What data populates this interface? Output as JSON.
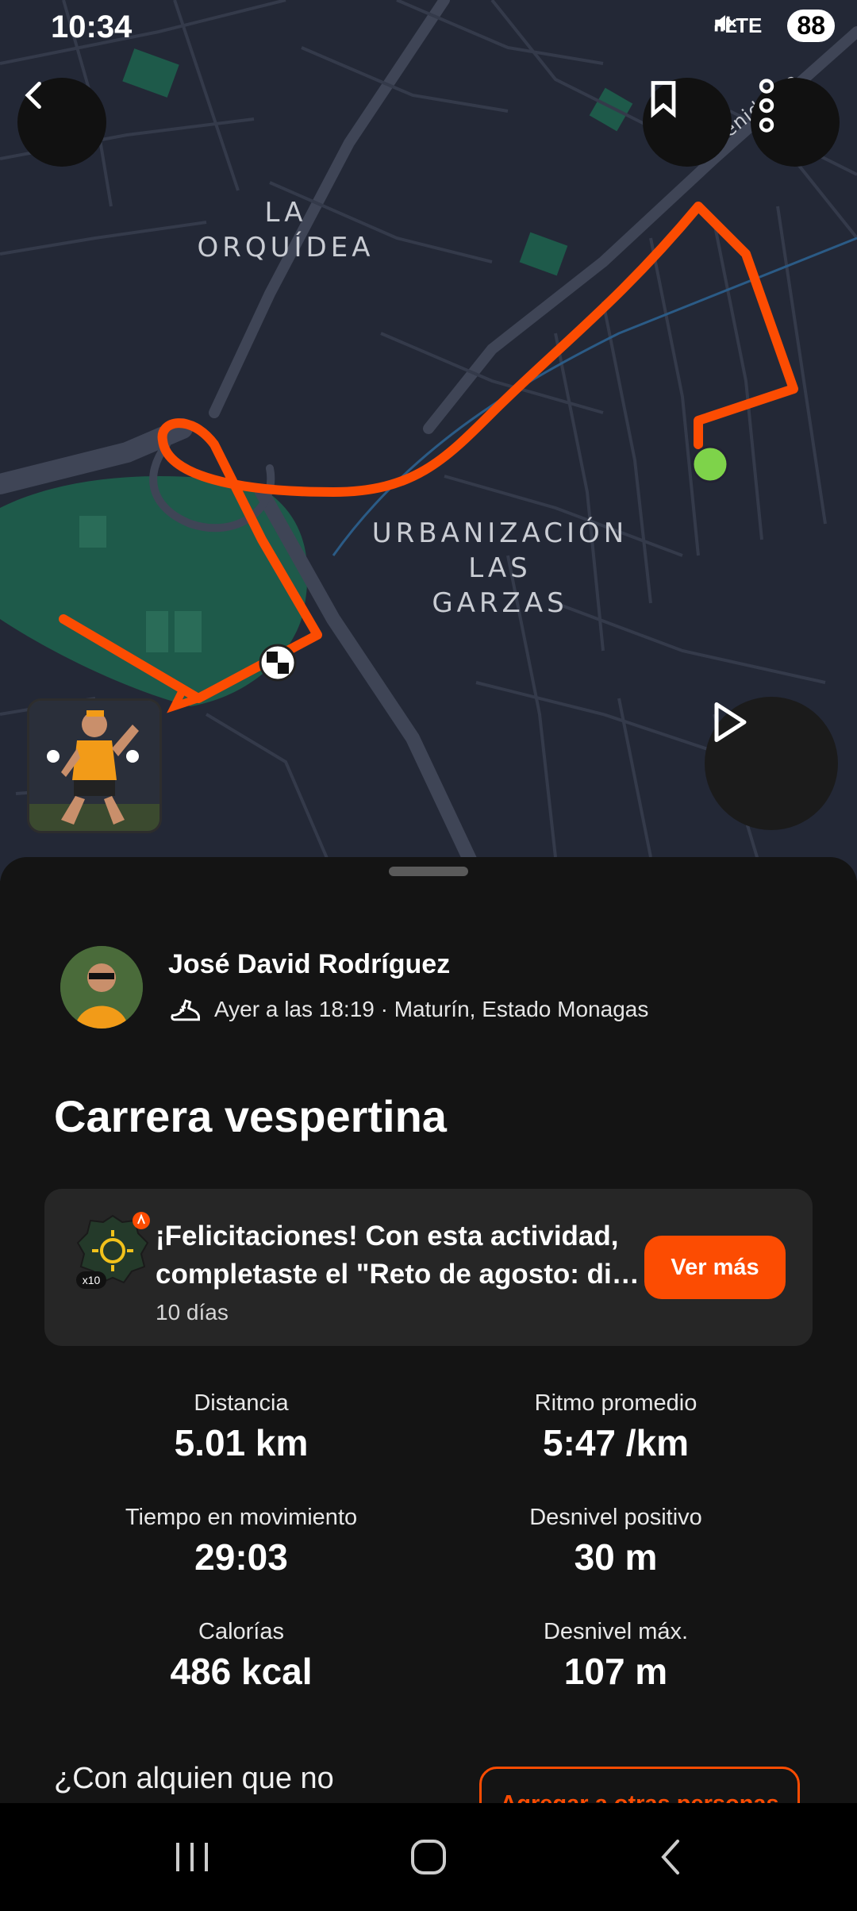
{
  "status_bar": {
    "time": "10:34",
    "network": "LTE",
    "battery": "88"
  },
  "map": {
    "labels": {
      "la_orquidea": [
        "LA",
        "ORQUÍDEA"
      ],
      "urbanizacion": [
        "URBANIZACIÓN",
        "LAS",
        "GARZAS"
      ],
      "street": "Avenida Be"
    },
    "route_color": "#fc4c02"
  },
  "header_buttons": {
    "back_icon": "chevron-left-icon",
    "bookmark_icon": "bookmark-icon",
    "more_icon": "more-vertical-icon",
    "play_icon": "play-icon"
  },
  "activity": {
    "athlete": "José David Rodríguez",
    "meta": "Ayer a las 18:19 · Maturín, Estado Monagas",
    "title": "Carrera vespertina"
  },
  "challenge": {
    "text": "¡Felicitaciones! Con esta actividad, completaste el \"Reto de agosto: di…",
    "sub": "10 días",
    "button": "Ver más",
    "badge_count": "x10"
  },
  "stats": [
    {
      "label": "Distancia",
      "value": "5.01 km"
    },
    {
      "label": "Ritmo promedio",
      "value": "5:47 /km"
    },
    {
      "label": "Tiempo en movimiento",
      "value": "29:03"
    },
    {
      "label": "Desnivel positivo",
      "value": "30 m"
    },
    {
      "label": "Calorías",
      "value": "486 kcal"
    },
    {
      "label": "Desnivel máx.",
      "value": "107 m"
    }
  ],
  "footer": {
    "question": "¿Con alquien que no",
    "add_button": "Agregar a otras personas"
  },
  "colors": {
    "accent": "#fc4c02",
    "map_bg": "#232836",
    "park": "#1e5a4a"
  }
}
